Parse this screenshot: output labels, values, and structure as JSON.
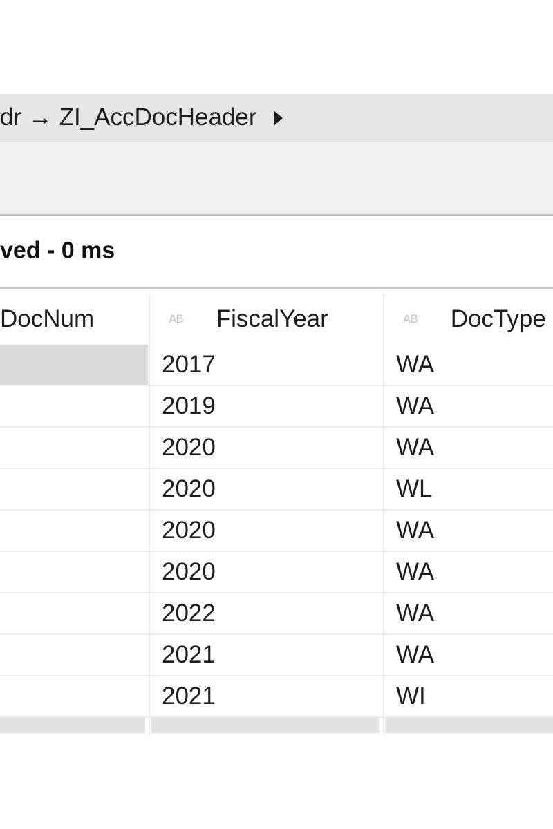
{
  "breadcrumb": {
    "text": "dr → ZI_AccDocHeader"
  },
  "status": {
    "text": "ved - 0 ms"
  },
  "grid": {
    "columns": [
      {
        "label": "DocNum",
        "icon": ""
      },
      {
        "label": "FiscalYear",
        "icon": "AB"
      },
      {
        "label": "DocType",
        "icon": "AB"
      }
    ],
    "rows": [
      {
        "fiscal_year": "2017",
        "doc_type": "WA"
      },
      {
        "fiscal_year": "2019",
        "doc_type": "WA"
      },
      {
        "fiscal_year": "2020",
        "doc_type": "WA"
      },
      {
        "fiscal_year": "2020",
        "doc_type": "WL"
      },
      {
        "fiscal_year": "2020",
        "doc_type": "WA"
      },
      {
        "fiscal_year": "2020",
        "doc_type": "WA"
      },
      {
        "fiscal_year": "2022",
        "doc_type": "WA"
      },
      {
        "fiscal_year": "2021",
        "doc_type": "WA"
      },
      {
        "fiscal_year": "2021",
        "doc_type": "WI"
      }
    ]
  }
}
